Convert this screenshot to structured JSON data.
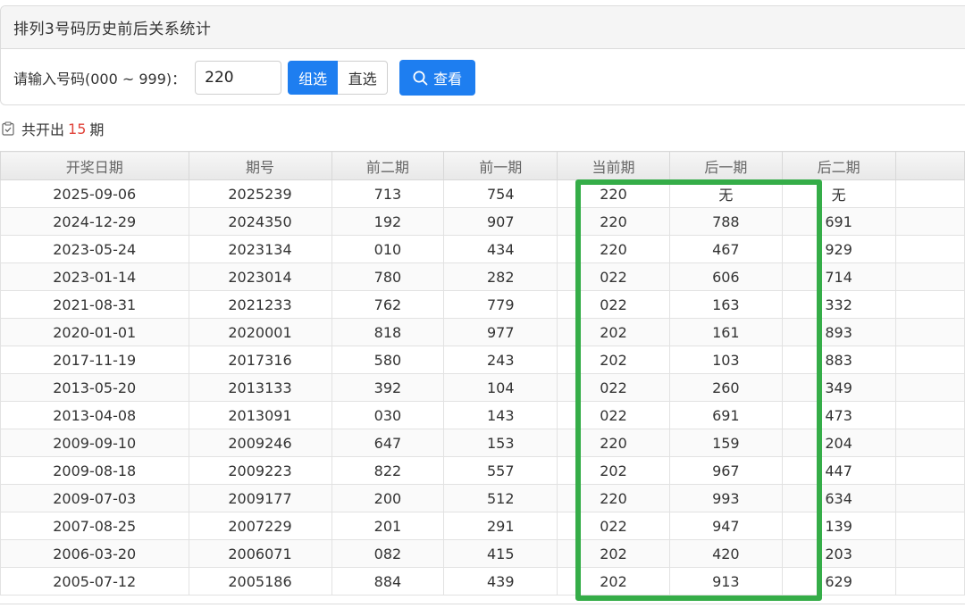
{
  "panel": {
    "title": "排列3号码历史前后关系统计"
  },
  "query": {
    "label": "请输入号码(000 ~ 999)：",
    "input_value": "220",
    "mode_group": "组选",
    "mode_direct": "直选",
    "search_label": "查看",
    "accent_color": "#1e7ef0"
  },
  "summary": {
    "prefix": "共开出",
    "count": "15",
    "suffix": "期"
  },
  "table": {
    "columns": [
      "开奖日期",
      "期号",
      "前二期",
      "前一期",
      "当前期",
      "后一期",
      "后二期"
    ],
    "rows": [
      [
        "2025-09-06",
        "2025239",
        "713",
        "754",
        "220",
        "无",
        "无"
      ],
      [
        "2024-12-29",
        "2024350",
        "192",
        "907",
        "220",
        "788",
        "691"
      ],
      [
        "2023-05-24",
        "2023134",
        "010",
        "434",
        "220",
        "467",
        "929"
      ],
      [
        "2023-01-14",
        "2023014",
        "780",
        "282",
        "022",
        "606",
        "714"
      ],
      [
        "2021-08-31",
        "2021233",
        "762",
        "779",
        "022",
        "163",
        "332"
      ],
      [
        "2020-01-01",
        "2020001",
        "818",
        "977",
        "202",
        "161",
        "893"
      ],
      [
        "2017-11-19",
        "2017316",
        "580",
        "243",
        "202",
        "103",
        "883"
      ],
      [
        "2013-05-20",
        "2013133",
        "392",
        "104",
        "022",
        "260",
        "349"
      ],
      [
        "2013-04-08",
        "2013091",
        "030",
        "143",
        "022",
        "691",
        "473"
      ],
      [
        "2009-09-10",
        "2009246",
        "647",
        "153",
        "220",
        "159",
        "204"
      ],
      [
        "2009-08-18",
        "2009223",
        "822",
        "557",
        "202",
        "967",
        "447"
      ],
      [
        "2009-07-03",
        "2009177",
        "200",
        "512",
        "220",
        "993",
        "634"
      ],
      [
        "2007-08-25",
        "2007229",
        "201",
        "291",
        "022",
        "947",
        "139"
      ],
      [
        "2006-03-20",
        "2006071",
        "082",
        "415",
        "202",
        "420",
        "203"
      ],
      [
        "2005-07-12",
        "2005186",
        "884",
        "439",
        "202",
        "913",
        "629"
      ]
    ],
    "highlight_color": "#35ad48"
  }
}
